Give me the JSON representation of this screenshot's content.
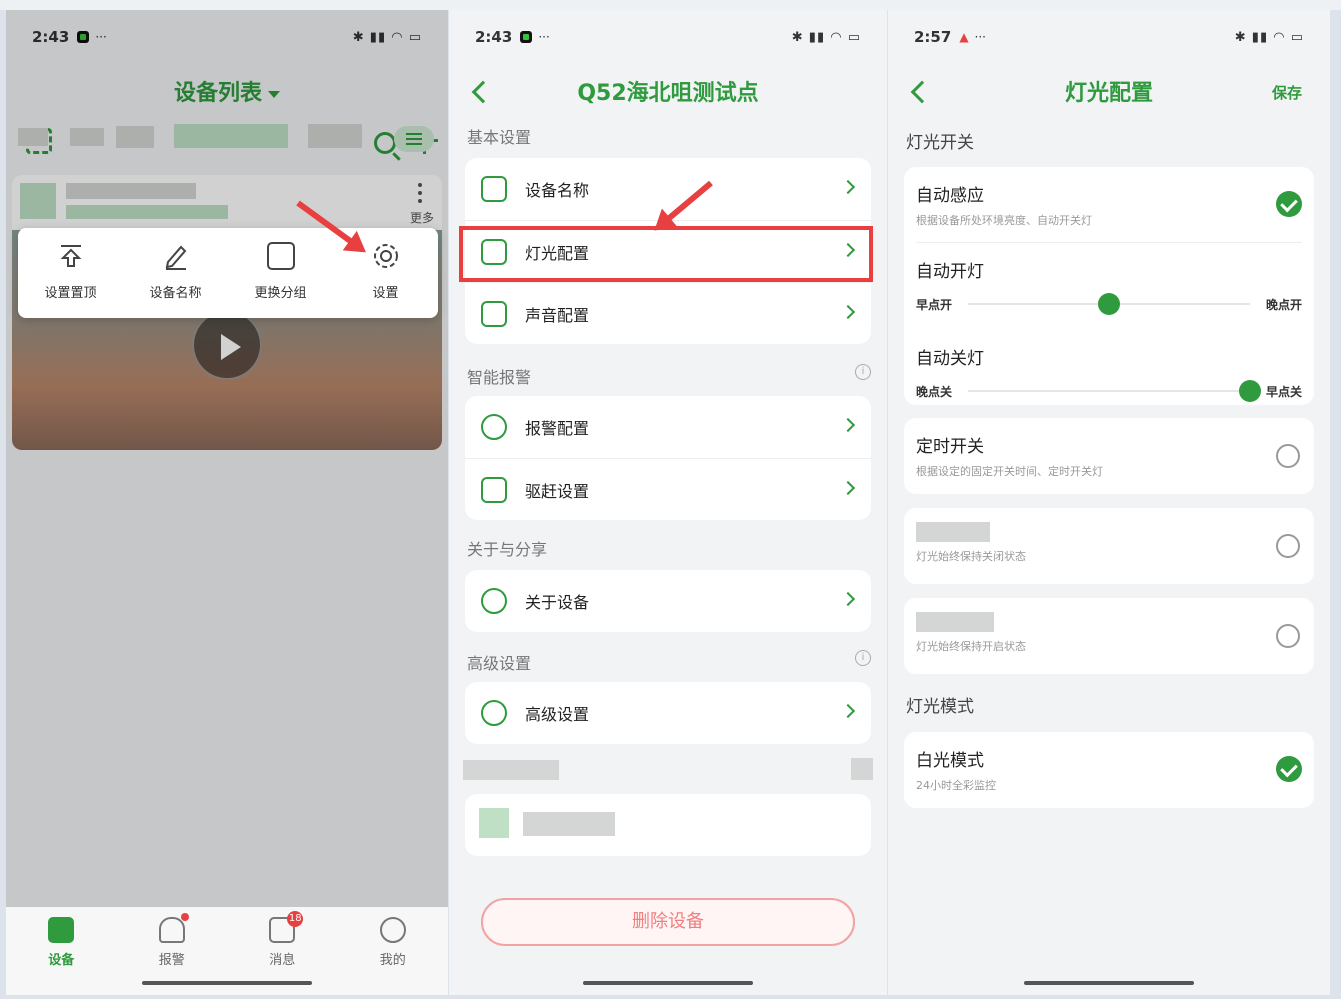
{
  "panel1": {
    "status_time": "2:43",
    "title": "设备列表",
    "more_label": "更多",
    "popup_items": [
      "设置置顶",
      "设备名称",
      "更换分组",
      "设置"
    ],
    "tabs": [
      {
        "label": "设备",
        "icon": "device-icon"
      },
      {
        "label": "报警",
        "icon": "bell-icon"
      },
      {
        "label": "消息",
        "icon": "message-icon",
        "badge": "18"
      },
      {
        "label": "我的",
        "icon": "user-icon"
      }
    ]
  },
  "panel2": {
    "status_time": "2:43",
    "title": "Q52海北咀测试点",
    "sections": [
      {
        "title": "基本设置",
        "rows": [
          "设备名称",
          "灯光配置",
          "声音配置"
        ]
      },
      {
        "title": "智能报警",
        "rows": [
          "报警配置",
          "驱赶设置"
        ]
      },
      {
        "title": "关于与分享",
        "rows": [
          "关于设备"
        ]
      },
      {
        "title": "高级设置",
        "rows": [
          "高级设置"
        ]
      }
    ],
    "delete_label": "删除设备"
  },
  "panel3": {
    "status_time": "2:57",
    "title": "灯光配置",
    "save_label": "保存",
    "switch_section": "灯光开关",
    "auto_sense": {
      "title": "自动感应",
      "desc": "根据设备所处环境亮度、自动开关灯",
      "checked": true
    },
    "auto_on": {
      "title": "自动开灯",
      "left": "早点开",
      "right": "晚点开",
      "level": 0.5
    },
    "auto_off": {
      "title": "自动关灯",
      "left": "晚点关",
      "right": "早点关",
      "level": 1.0
    },
    "timer": {
      "title": "定时开关",
      "desc": "根据设定的固定开关时间、定时开关灯"
    },
    "always_off": {
      "desc": "灯光始终保持关闭状态"
    },
    "always_on": {
      "desc": "灯光始终保持开启状态"
    },
    "mode_section": "灯光模式",
    "white_mode": {
      "title": "白光模式",
      "desc": "24小时全彩监控",
      "checked": true
    }
  },
  "colors": {
    "accent": "#2f9a3e",
    "alert": "#e84040"
  }
}
